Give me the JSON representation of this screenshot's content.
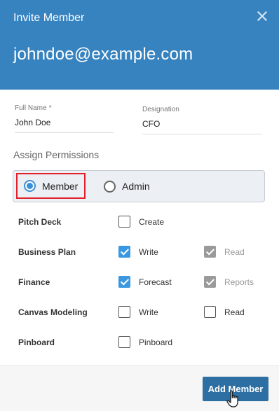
{
  "header": {
    "title": "Invite Member",
    "email": "johndoe@example.com"
  },
  "form": {
    "full_name": {
      "label": "Full Name",
      "required_mark": "*",
      "value": "John Doe"
    },
    "designation": {
      "label": "Designation",
      "value": "CFO"
    }
  },
  "permissions": {
    "heading": "Assign Permissions",
    "options": [
      {
        "label": "Member",
        "selected": true
      },
      {
        "label": "Admin",
        "selected": false
      }
    ],
    "rows": [
      {
        "name": "Pitch Deck",
        "items": [
          {
            "label": "Create",
            "checked": false,
            "disabled": false
          }
        ]
      },
      {
        "name": "Business Plan",
        "items": [
          {
            "label": "Write",
            "checked": true,
            "disabled": false
          },
          {
            "label": "Read",
            "checked": true,
            "disabled": true
          }
        ]
      },
      {
        "name": "Finance",
        "items": [
          {
            "label": "Forecast",
            "checked": true,
            "disabled": false
          },
          {
            "label": "Reports",
            "checked": true,
            "disabled": true
          }
        ]
      },
      {
        "name": "Canvas Modeling",
        "items": [
          {
            "label": "Write",
            "checked": false,
            "disabled": false
          },
          {
            "label": "Read",
            "checked": false,
            "disabled": false
          }
        ]
      },
      {
        "name": "Pinboard",
        "items": [
          {
            "label": "Pinboard",
            "checked": false,
            "disabled": false
          }
        ]
      }
    ]
  },
  "footer": {
    "add_button": "Add Member"
  },
  "colors": {
    "header": "#3783c0",
    "accent": "#3b98e0",
    "button": "#2d6fa3",
    "highlight": "#e2202a"
  }
}
